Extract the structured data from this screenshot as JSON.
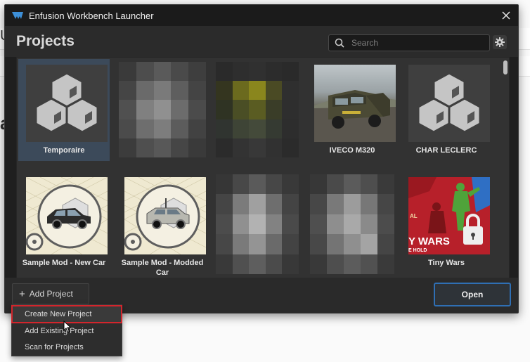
{
  "window": {
    "title": "Enfusion Workbench Launcher"
  },
  "header": {
    "title": "Projects",
    "search_placeholder": "Search"
  },
  "projects": [
    {
      "label": "Temporaire",
      "thumb": "placeholder",
      "selected": true
    },
    {
      "label": "",
      "thumb": "blurred"
    },
    {
      "label": "",
      "thumb": "blurred"
    },
    {
      "label": "IVECO M320",
      "thumb": "truck"
    },
    {
      "label": "CHAR LECLERC",
      "thumb": "placeholder"
    },
    {
      "label": "Sample Mod - New Car",
      "thumb": "sample-car"
    },
    {
      "label": "Sample Mod - Modded Car",
      "thumb": "sample-modded-car"
    },
    {
      "label": "",
      "thumb": "blurred"
    },
    {
      "label": "",
      "thumb": "blurred"
    },
    {
      "label": "Tiny Wars",
      "thumb": "tiny-wars",
      "locked": true,
      "thumb_text": "Y WARS",
      "thumb_subtext": "E HOLD",
      "thumb_corner": "AL"
    }
  ],
  "footer": {
    "add_project_label": "Add Project",
    "open_label": "Open"
  },
  "menu": {
    "items": [
      "Create New Project",
      "Add Existing Project",
      "Scan for Projects"
    ]
  },
  "background": {
    "letter_top": "U",
    "letter_mid": "a"
  },
  "colors": {
    "accent": "#2f6fb4",
    "highlight_border": "#d3252c",
    "selected_tile": "#3c4a5a"
  }
}
